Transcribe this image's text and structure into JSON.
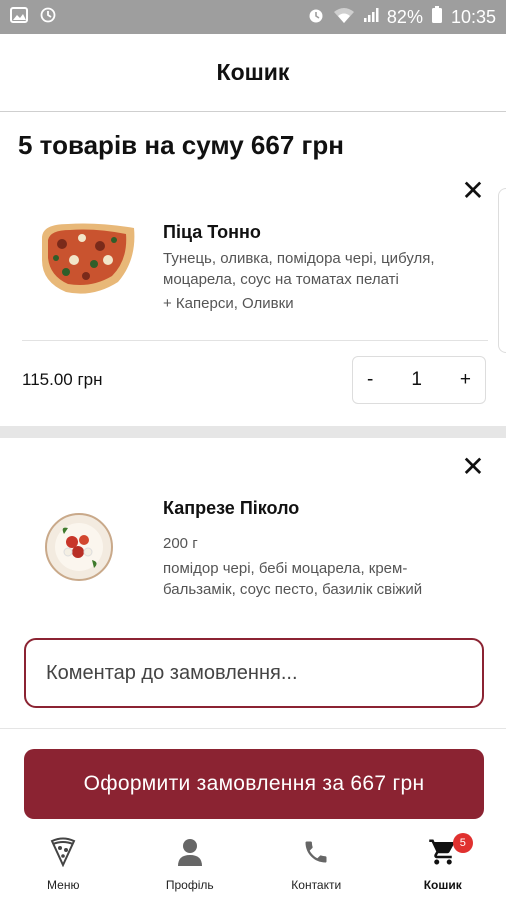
{
  "status_bar": {
    "battery": "82%",
    "time": "10:35",
    "icons": [
      "image-icon",
      "clock-icon",
      "alarm-icon",
      "wifi-icon",
      "signal-icon",
      "battery-icon"
    ]
  },
  "header": {
    "title": "Кошик"
  },
  "summary": "5 товарів на суму 667 грн",
  "cart_items": [
    {
      "name": "Піца Тонно",
      "description": "Тунець, оливка, помідора чері, цибуля, моцарела, соус на томатах пелаті",
      "extras": "+ Каперси, Оливки",
      "price": "115.00 грн",
      "quantity": "1",
      "minus": "-",
      "plus": "+",
      "close": "✕"
    },
    {
      "name": "Капрезе Піколо",
      "weight": "200 г",
      "description": "помідор чері, бебі моцарела, крем-бальзамік, соус песто, базилік свіжий",
      "close": "✕"
    }
  ],
  "comment": {
    "placeholder": "Коментар до замовлення..."
  },
  "checkout": {
    "label": "Оформити замовлення за 667 грн"
  },
  "tabbar": {
    "tabs": [
      {
        "label": "Меню",
        "icon": "pizza-slice-icon"
      },
      {
        "label": "Профіль",
        "icon": "user-icon"
      },
      {
        "label": "Контакти",
        "icon": "phone-icon"
      },
      {
        "label": "Кошик",
        "icon": "cart-icon",
        "badge": "5",
        "active": true
      }
    ]
  },
  "colors": {
    "accent": "#8b2332",
    "badge": "#e0312f",
    "status_bar": "#9e9e9e"
  }
}
